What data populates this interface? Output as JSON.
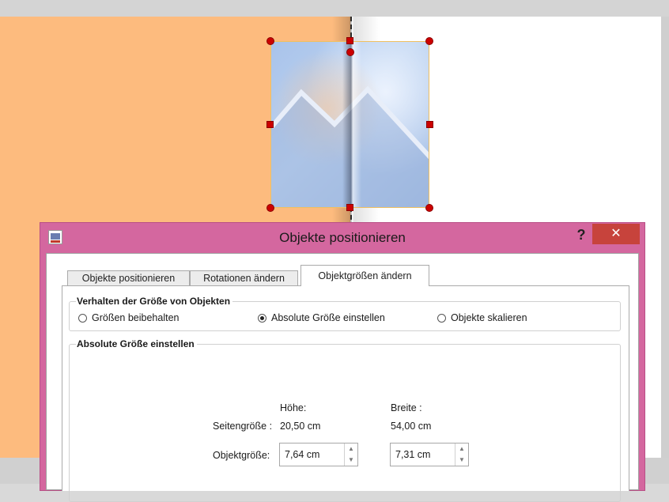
{
  "dialog": {
    "title": "Objekte positionieren",
    "help_label": "?",
    "close_label": "✕",
    "tabs": [
      {
        "label": "Objekte positionieren"
      },
      {
        "label": "Rotationen ändern"
      },
      {
        "label": "Objektgrößen ändern"
      }
    ],
    "size_behavior": {
      "title": "Verhalten der Größe von Objekten",
      "options": [
        {
          "label": "Größen beibehalten",
          "selected": false
        },
        {
          "label": "Absolute Größe einstellen",
          "selected": true
        },
        {
          "label": "Objekte skalieren",
          "selected": false
        }
      ]
    },
    "absolute_size": {
      "title": "Absolute Größe einstellen",
      "height_header": "Höhe:",
      "width_header": "Breite :",
      "page_size_label": "Seitengröße :",
      "page_height": "20,50 cm",
      "page_width": "54,00 cm",
      "object_size_label": "Objektgröße:",
      "object_height": "7,64 cm",
      "object_width": "7,31 cm"
    }
  },
  "colors": {
    "left_page": "#fdbb7e",
    "dialog_frame": "#d4679f",
    "close_button": "#c7433c",
    "handle": "#cc0000"
  },
  "icons": {
    "spin_up": "▲",
    "spin_down": "▼"
  }
}
